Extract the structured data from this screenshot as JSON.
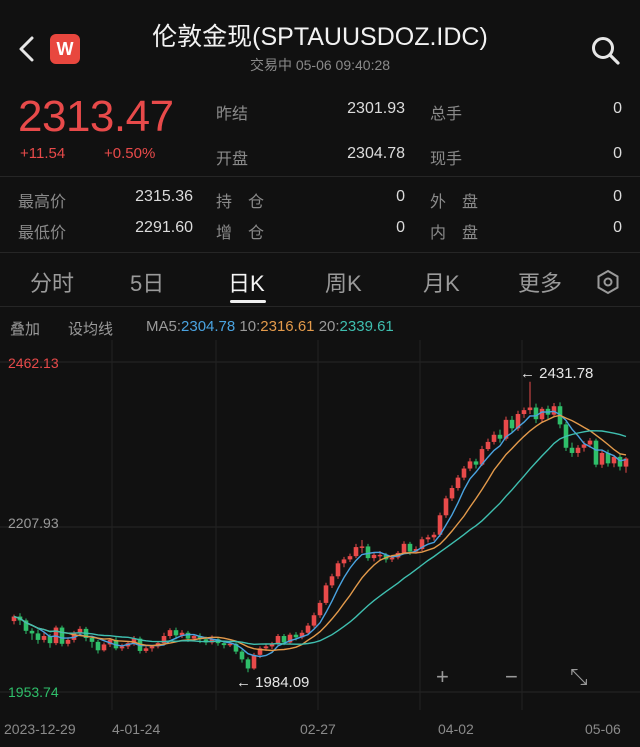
{
  "header": {
    "title": "伦敦金现(SPTAUUSDOZ.IDC)",
    "subtitle": "交易中 05-06 09:40:28",
    "logo_letter": "W"
  },
  "quote": {
    "price": "2313.47",
    "change": "+11.54",
    "change_pct": "+0.50%",
    "stats": [
      {
        "label": "昨结",
        "value": "2301.93"
      },
      {
        "label": "总手",
        "value": "0"
      },
      {
        "label": "开盘",
        "value": "2304.78"
      },
      {
        "label": "现手",
        "value": "0"
      },
      {
        "label": "最高价",
        "value": "2315.36"
      },
      {
        "label": "持　仓",
        "value": "0"
      },
      {
        "label": "外　盘",
        "value": "0"
      },
      {
        "label": "最低价",
        "value": "2291.60"
      },
      {
        "label": "增　仓",
        "value": "0"
      },
      {
        "label": "内　盘",
        "value": "0"
      }
    ]
  },
  "tabs": [
    "分时",
    "5日",
    "日K",
    "周K",
    "月K",
    "更多"
  ],
  "active_tab": "日K",
  "indicators": {
    "overlay": "叠加",
    "set_ma": "设均线",
    "ma5_label": "MA5:",
    "ma5_value": "2304.78",
    "ma10_label": "10:",
    "ma10_value": "2316.61",
    "ma20_label": "20:",
    "ma20_value": "2339.61"
  },
  "colors": {
    "up": "#e84a4a",
    "down": "#2fbf6a",
    "ma5": "#4aa3e0",
    "ma10": "#e39a4b",
    "ma20": "#3fbfb0"
  },
  "chart_data": {
    "type": "candlestick",
    "y_ticks": [
      "2462.13",
      "2207.93",
      "1953.74"
    ],
    "x_ticks": [
      "2023-12-29",
      "4-01-24",
      "02-27",
      "04-02",
      "05-06"
    ],
    "ylim": [
      1953.74,
      2462.13
    ],
    "high_annotation": "2431.78",
    "low_annotation": "1984.09",
    "high_value": 2431.78,
    "low_value": 1984.09,
    "candles": [
      [
        2063,
        2070,
        2058,
        2073
      ],
      [
        2070,
        2064,
        2057,
        2075
      ],
      [
        2064,
        2048,
        2043,
        2067
      ],
      [
        2048,
        2044,
        2034,
        2052
      ],
      [
        2044,
        2034,
        2028,
        2050
      ],
      [
        2034,
        2040,
        2030,
        2046
      ],
      [
        2040,
        2029,
        2022,
        2043
      ],
      [
        2029,
        2053,
        2026,
        2056
      ],
      [
        2053,
        2028,
        2024,
        2056
      ],
      [
        2028,
        2034,
        2024,
        2038
      ],
      [
        2034,
        2045,
        2030,
        2048
      ],
      [
        2045,
        2051,
        2042,
        2055
      ],
      [
        2051,
        2037,
        2032,
        2054
      ],
      [
        2037,
        2031,
        2022,
        2040
      ],
      [
        2031,
        2018,
        2013,
        2034
      ],
      [
        2018,
        2027,
        2016,
        2030
      ],
      [
        2027,
        2034,
        2023,
        2037
      ],
      [
        2034,
        2021,
        2018,
        2038
      ],
      [
        2021,
        2024,
        2017,
        2028
      ],
      [
        2024,
        2029,
        2020,
        2032
      ],
      [
        2029,
        2036,
        2025,
        2040
      ],
      [
        2036,
        2017,
        2013,
        2039
      ],
      [
        2017,
        2021,
        2014,
        2024
      ],
      [
        2021,
        2024,
        2016,
        2026
      ],
      [
        2024,
        2029,
        2021,
        2032
      ],
      [
        2029,
        2040,
        2026,
        2045
      ],
      [
        2040,
        2049,
        2036,
        2052
      ],
      [
        2049,
        2041,
        2035,
        2053
      ],
      [
        2041,
        2045,
        2037,
        2049
      ],
      [
        2045,
        2036,
        2031,
        2048
      ],
      [
        2036,
        2040,
        2033,
        2043
      ],
      [
        2040,
        2035,
        2029,
        2044
      ],
      [
        2035,
        2030,
        2026,
        2039
      ],
      [
        2030,
        2035,
        2027,
        2041
      ],
      [
        2035,
        2029,
        2025,
        2037
      ],
      [
        2029,
        2026,
        2021,
        2033
      ],
      [
        2026,
        2028,
        2023,
        2031
      ],
      [
        2028,
        2016,
        2012,
        2030
      ],
      [
        2016,
        2004,
        1999,
        2019
      ],
      [
        2004,
        1990,
        1984.09,
        2007
      ],
      [
        1990,
        2011,
        1988,
        2014
      ],
      [
        2011,
        2021,
        2006,
        2024
      ],
      [
        2021,
        2024,
        2017,
        2027
      ],
      [
        2024,
        2028,
        2020,
        2031
      ],
      [
        2028,
        2040,
        2025,
        2043
      ],
      [
        2040,
        2030,
        2026,
        2043
      ],
      [
        2030,
        2042,
        2028,
        2045
      ],
      [
        2042,
        2038,
        2033,
        2046
      ],
      [
        2038,
        2045,
        2035,
        2049
      ],
      [
        2045,
        2056,
        2042,
        2060
      ],
      [
        2056,
        2072,
        2053,
        2076
      ],
      [
        2072,
        2091,
        2068,
        2095
      ],
      [
        2091,
        2118,
        2088,
        2122
      ],
      [
        2118,
        2132,
        2114,
        2136
      ],
      [
        2132,
        2152,
        2128,
        2156
      ],
      [
        2152,
        2158,
        2146,
        2162
      ],
      [
        2158,
        2163,
        2154,
        2167
      ],
      [
        2163,
        2177,
        2160,
        2182
      ],
      [
        2177,
        2178,
        2168,
        2188
      ],
      [
        2178,
        2160,
        2156,
        2182
      ],
      [
        2160,
        2165,
        2155,
        2169
      ],
      [
        2165,
        2165,
        2157,
        2171
      ],
      [
        2165,
        2158,
        2153,
        2168
      ],
      [
        2158,
        2161,
        2154,
        2165
      ],
      [
        2161,
        2168,
        2158,
        2171
      ],
      [
        2168,
        2182,
        2166,
        2186
      ],
      [
        2182,
        2170,
        2165,
        2185
      ],
      [
        2170,
        2174,
        2167,
        2178
      ],
      [
        2174,
        2189,
        2171,
        2193
      ],
      [
        2189,
        2192,
        2184,
        2196
      ],
      [
        2192,
        2196,
        2187,
        2200
      ],
      [
        2196,
        2226,
        2193,
        2230
      ],
      [
        2226,
        2252,
        2222,
        2256
      ],
      [
        2252,
        2268,
        2248,
        2272
      ],
      [
        2268,
        2284,
        2264,
        2288
      ],
      [
        2284,
        2298,
        2280,
        2302
      ],
      [
        2298,
        2309,
        2294,
        2314
      ],
      [
        2309,
        2304,
        2298,
        2313
      ],
      [
        2304,
        2328,
        2302,
        2333
      ],
      [
        2328,
        2339,
        2325,
        2344
      ],
      [
        2339,
        2350,
        2335,
        2355
      ],
      [
        2350,
        2344,
        2338,
        2358
      ],
      [
        2344,
        2373,
        2341,
        2378
      ],
      [
        2373,
        2360,
        2353,
        2379
      ],
      [
        2360,
        2382,
        2356,
        2387
      ],
      [
        2382,
        2388,
        2376,
        2392
      ],
      [
        2388,
        2392,
        2382,
        2431.78
      ],
      [
        2392,
        2374,
        2368,
        2398
      ],
      [
        2374,
        2390,
        2370,
        2393
      ],
      [
        2390,
        2381,
        2374,
        2395
      ],
      [
        2381,
        2394,
        2378,
        2399
      ],
      [
        2394,
        2366,
        2360,
        2400
      ],
      [
        2366,
        2330,
        2325,
        2370
      ],
      [
        2330,
        2322,
        2316,
        2338
      ],
      [
        2322,
        2330,
        2316,
        2334
      ],
      [
        2330,
        2335,
        2324,
        2340
      ],
      [
        2335,
        2341,
        2330,
        2345
      ],
      [
        2341,
        2304,
        2300,
        2344
      ],
      [
        2304,
        2322,
        2299,
        2326
      ],
      [
        2322,
        2306,
        2301,
        2327
      ],
      [
        2306,
        2316,
        2300,
        2319
      ],
      [
        2316,
        2301,
        2295,
        2320
      ],
      [
        2301,
        2313.47,
        2291.6,
        2315.36
      ]
    ]
  },
  "controls": {
    "zoom_in": "+",
    "zoom_out": "−",
    "fullscreen": "⤡"
  }
}
